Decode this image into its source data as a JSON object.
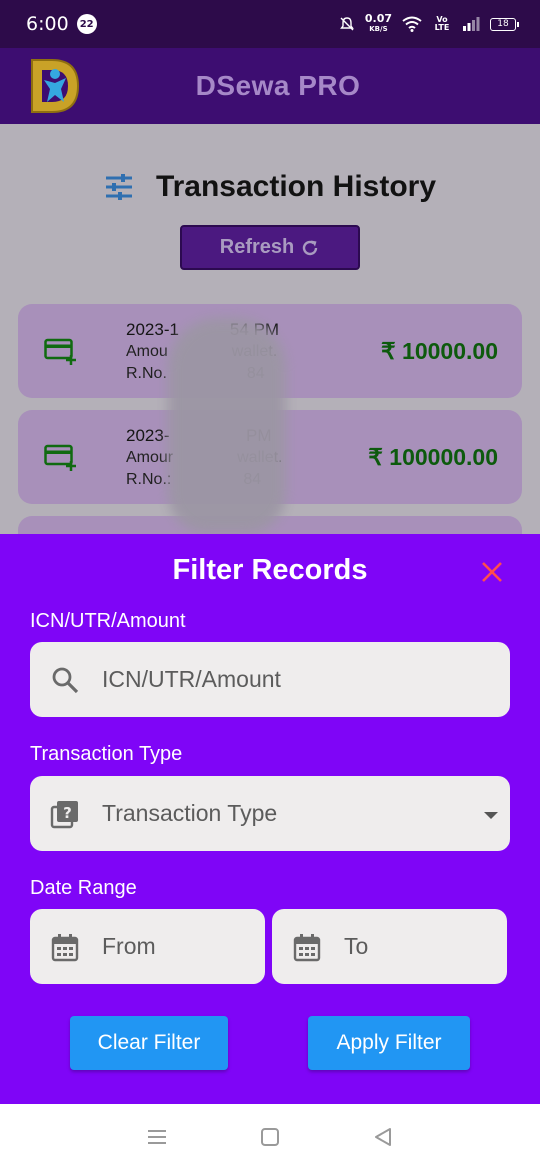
{
  "status_bar": {
    "time": "6:00",
    "notification_count": "22",
    "net_speed": "0.07",
    "net_unit": "KB/S",
    "network_type": "Vo LTE",
    "battery": "18"
  },
  "app_bar": {
    "title": "DSewa PRO",
    "logo_letter": "D"
  },
  "page": {
    "title": "Transaction History",
    "refresh_label": "Refresh"
  },
  "transactions": [
    {
      "line1": "2023-1      54 PM",
      "line2": "Amou        wallet.",
      "line3": "R.No.          84",
      "amount": "₹ 10000.00"
    },
    {
      "line1": "2023-         PM",
      "line2": "Amour        wallet.",
      "line3": "R.No.:         84",
      "amount": "₹ 100000.00"
    }
  ],
  "filter_sheet": {
    "title": "Filter Records",
    "search_label": "ICN/UTR/Amount",
    "search_placeholder": "ICN/UTR/Amount",
    "type_label": "Transaction Type",
    "type_placeholder": "Transaction Type",
    "date_label": "Date Range",
    "from_placeholder": "From",
    "to_placeholder": "To",
    "clear_label": "Clear Filter",
    "apply_label": "Apply Filter"
  },
  "colors": {
    "sheet_bg": "#7f05f7",
    "app_bar_bg": "#3d0d71",
    "button_blue": "#2196f3",
    "amount_green": "#0d5a0d",
    "close_red": "#ff4d4d"
  },
  "icons": {
    "tune": "tune-icon",
    "refresh": "refresh-icon",
    "add_card": "add-card-icon",
    "search": "search-icon",
    "help_box": "help-box-icon",
    "calendar": "calendar-icon",
    "close": "close-icon"
  }
}
